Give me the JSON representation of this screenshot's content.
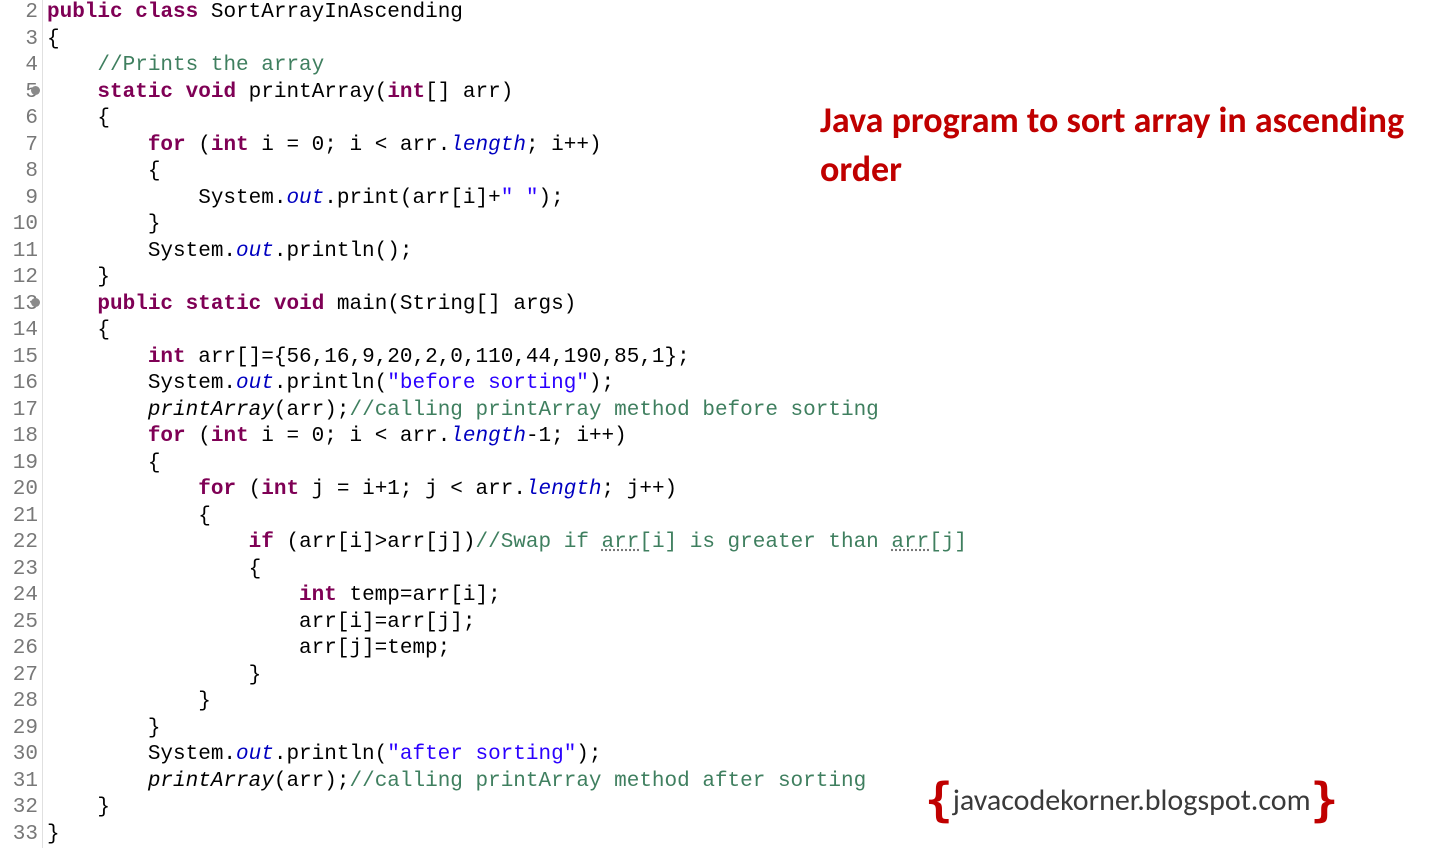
{
  "title": "Java program to sort\narray in ascending order",
  "watermark": {
    "text": "javacodekorner.blogspot.com",
    "left_brace": "{",
    "right_brace": "}"
  },
  "lines": [
    {
      "n": "2",
      "marker": false,
      "tokens": [
        [
          "kw",
          "public"
        ],
        [
          "",
          " "
        ],
        [
          "kw",
          "class"
        ],
        [
          "",
          " SortArrayInAscending"
        ]
      ]
    },
    {
      "n": "3",
      "marker": false,
      "tokens": [
        [
          "",
          "{"
        ]
      ]
    },
    {
      "n": "4",
      "marker": false,
      "tokens": [
        [
          "",
          "    "
        ],
        [
          "cm",
          "//Prints the array"
        ]
      ]
    },
    {
      "n": "5",
      "marker": true,
      "tokens": [
        [
          "",
          "    "
        ],
        [
          "kw",
          "static"
        ],
        [
          "",
          " "
        ],
        [
          "kw",
          "void"
        ],
        [
          "",
          " printArray("
        ],
        [
          "kw",
          "int"
        ],
        [
          "",
          "[] arr)"
        ]
      ]
    },
    {
      "n": "6",
      "marker": false,
      "tokens": [
        [
          "",
          "    {"
        ]
      ]
    },
    {
      "n": "7",
      "marker": false,
      "tokens": [
        [
          "",
          "        "
        ],
        [
          "kw",
          "for"
        ],
        [
          "",
          " ("
        ],
        [
          "kw",
          "int"
        ],
        [
          "",
          " i = 0; i < arr."
        ],
        [
          "field",
          "length"
        ],
        [
          "",
          "; i++)"
        ]
      ]
    },
    {
      "n": "8",
      "marker": false,
      "tokens": [
        [
          "",
          "        {"
        ]
      ]
    },
    {
      "n": "9",
      "marker": false,
      "tokens": [
        [
          "",
          "            System."
        ],
        [
          "field",
          "out"
        ],
        [
          "",
          ".print(arr[i]+"
        ],
        [
          "str",
          "\" \""
        ],
        [
          "",
          ");"
        ]
      ]
    },
    {
      "n": "10",
      "marker": false,
      "tokens": [
        [
          "",
          "        }"
        ]
      ]
    },
    {
      "n": "11",
      "marker": false,
      "tokens": [
        [
          "",
          "        System."
        ],
        [
          "field",
          "out"
        ],
        [
          "",
          ".println();"
        ]
      ]
    },
    {
      "n": "12",
      "marker": false,
      "tokens": [
        [
          "",
          "    }"
        ]
      ]
    },
    {
      "n": "13",
      "marker": true,
      "tokens": [
        [
          "",
          "    "
        ],
        [
          "kw",
          "public"
        ],
        [
          "",
          " "
        ],
        [
          "kw",
          "static"
        ],
        [
          "",
          " "
        ],
        [
          "kw",
          "void"
        ],
        [
          "",
          " main(String[] args)"
        ]
      ]
    },
    {
      "n": "14",
      "marker": false,
      "tokens": [
        [
          "",
          "    {"
        ]
      ]
    },
    {
      "n": "15",
      "marker": false,
      "tokens": [
        [
          "",
          "        "
        ],
        [
          "kw",
          "int"
        ],
        [
          "",
          " arr[]={56,16,9,20,2,0,110,44,190,85,1};"
        ]
      ]
    },
    {
      "n": "16",
      "marker": false,
      "tokens": [
        [
          "",
          "        System."
        ],
        [
          "field",
          "out"
        ],
        [
          "",
          ".println("
        ],
        [
          "str",
          "\"before sorting\""
        ],
        [
          "",
          ");"
        ]
      ]
    },
    {
      "n": "17",
      "marker": false,
      "tokens": [
        [
          "",
          "        "
        ],
        [
          "call-it",
          "printArray"
        ],
        [
          "",
          "(arr);"
        ],
        [
          "cm",
          "//calling printArray method before sorting"
        ]
      ]
    },
    {
      "n": "18",
      "marker": false,
      "tokens": [
        [
          "",
          "        "
        ],
        [
          "kw",
          "for"
        ],
        [
          "",
          " ("
        ],
        [
          "kw",
          "int"
        ],
        [
          "",
          " i = 0; i < arr."
        ],
        [
          "field",
          "length"
        ],
        [
          "",
          "-1; i++)"
        ]
      ]
    },
    {
      "n": "19",
      "marker": false,
      "tokens": [
        [
          "",
          "        {"
        ]
      ]
    },
    {
      "n": "20",
      "marker": false,
      "tokens": [
        [
          "",
          "            "
        ],
        [
          "kw",
          "for"
        ],
        [
          "",
          " ("
        ],
        [
          "kw",
          "int"
        ],
        [
          "",
          " j = i+1; j < arr."
        ],
        [
          "field",
          "length"
        ],
        [
          "",
          "; j++)"
        ]
      ]
    },
    {
      "n": "21",
      "marker": false,
      "tokens": [
        [
          "",
          "            {"
        ]
      ]
    },
    {
      "n": "22",
      "marker": false,
      "tokens": [
        [
          "",
          "                "
        ],
        [
          "kw",
          "if"
        ],
        [
          "",
          " (arr[i]>arr[j])"
        ],
        [
          "cm",
          "//Swap if "
        ],
        [
          "cm var-u",
          "arr"
        ],
        [
          "cm",
          "[i] is greater than "
        ],
        [
          "cm var-u",
          "arr"
        ],
        [
          "cm",
          "[j]"
        ]
      ]
    },
    {
      "n": "23",
      "marker": false,
      "tokens": [
        [
          "",
          "                {"
        ]
      ]
    },
    {
      "n": "24",
      "marker": false,
      "tokens": [
        [
          "",
          "                    "
        ],
        [
          "kw",
          "int"
        ],
        [
          "",
          " temp=arr[i];"
        ]
      ]
    },
    {
      "n": "25",
      "marker": false,
      "tokens": [
        [
          "",
          "                    arr[i]=arr[j];"
        ]
      ]
    },
    {
      "n": "26",
      "marker": false,
      "tokens": [
        [
          "",
          "                    arr[j]=temp;"
        ]
      ]
    },
    {
      "n": "27",
      "marker": false,
      "tokens": [
        [
          "",
          "                }"
        ]
      ]
    },
    {
      "n": "28",
      "marker": false,
      "tokens": [
        [
          "",
          "            }"
        ]
      ]
    },
    {
      "n": "29",
      "marker": false,
      "tokens": [
        [
          "",
          "        }"
        ]
      ]
    },
    {
      "n": "30",
      "marker": false,
      "tokens": [
        [
          "",
          "        System."
        ],
        [
          "field",
          "out"
        ],
        [
          "",
          ".println("
        ],
        [
          "str",
          "\"after sorting\""
        ],
        [
          "",
          ");"
        ]
      ]
    },
    {
      "n": "31",
      "marker": false,
      "tokens": [
        [
          "",
          "        "
        ],
        [
          "call-it",
          "printArray"
        ],
        [
          "",
          "(arr);"
        ],
        [
          "cm",
          "//calling printArray method after sorting"
        ]
      ]
    },
    {
      "n": "32",
      "marker": false,
      "tokens": [
        [
          "",
          "    }"
        ]
      ]
    },
    {
      "n": "33",
      "marker": false,
      "tokens": [
        [
          "",
          "}"
        ]
      ]
    }
  ]
}
